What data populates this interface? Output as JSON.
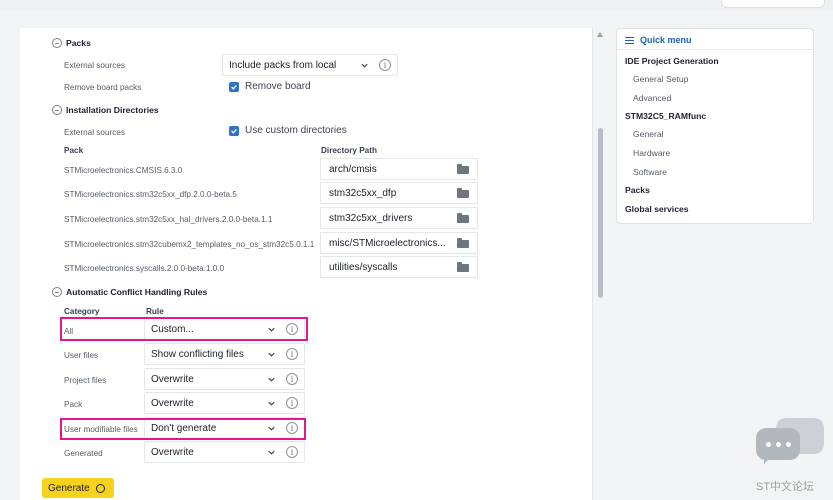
{
  "packs": {
    "title": "Packs",
    "external_sources_label": "External sources",
    "external_sources_value": "Include packs from local",
    "remove_board_label": "Remove board packs",
    "remove_board_checkbox": "Remove board"
  },
  "install_dirs": {
    "title": "Installation Directories",
    "external_sources_label": "External sources",
    "custom_dirs_checkbox": "Use custom directories",
    "col_pack": "Pack",
    "col_path": "Directory Path",
    "rows": [
      {
        "pack": "STMicroelectronics.CMSIS.6.3.0",
        "path": "arch/cmsis"
      },
      {
        "pack": "STMicroelectronics.stm32c5xx_dfp.2.0.0-beta.5",
        "path": "stm32c5xx_dfp"
      },
      {
        "pack": "STMicroelectronics.stm32c5xx_hal_drivers.2.0.0-beta.1.1",
        "path": "stm32c5xx_drivers"
      },
      {
        "pack": "STMicroelectronics.stm32cubemx2_templates_no_os_stm32c5.0.1.1",
        "path": "misc/STMicroelectronics..."
      },
      {
        "pack": "STMicroelectronics.syscalls.2.0.0-beta.1.0.0",
        "path": "utilities/syscalls"
      }
    ]
  },
  "conflict": {
    "title": "Automatic Conflict Handling Rules",
    "col_category": "Category",
    "col_rule": "Rule",
    "rows": [
      {
        "category": "All",
        "rule": "Custom..."
      },
      {
        "category": "User files",
        "rule": "Show conflicting files"
      },
      {
        "category": "Project files",
        "rule": "Overwrite"
      },
      {
        "category": "Pack",
        "rule": "Overwrite"
      },
      {
        "category": "User modifiable files",
        "rule": "Don't generate"
      },
      {
        "category": "Generated",
        "rule": "Overwrite"
      }
    ]
  },
  "generate_label": "Generate",
  "info_glyph": "i",
  "quick_menu": {
    "title": "Quick menu",
    "items": [
      {
        "label": "IDE Project Generation",
        "level": "header"
      },
      {
        "label": "General Setup",
        "level": "item"
      },
      {
        "label": "Advanced",
        "level": "item"
      },
      {
        "label": "STM32C5_RAMfunc",
        "level": "header"
      },
      {
        "label": "General",
        "level": "item"
      },
      {
        "label": "Hardware",
        "level": "item"
      },
      {
        "label": "Software",
        "level": "item"
      },
      {
        "label": "Packs",
        "level": "header"
      },
      {
        "label": "Global services",
        "level": "header"
      }
    ]
  },
  "watermark": "ST中文论坛",
  "colors": {
    "highlight": "#e6178c",
    "primary": "#2f73c8",
    "generate_button": "#f7d21d",
    "link": "#1e5fb8"
  }
}
